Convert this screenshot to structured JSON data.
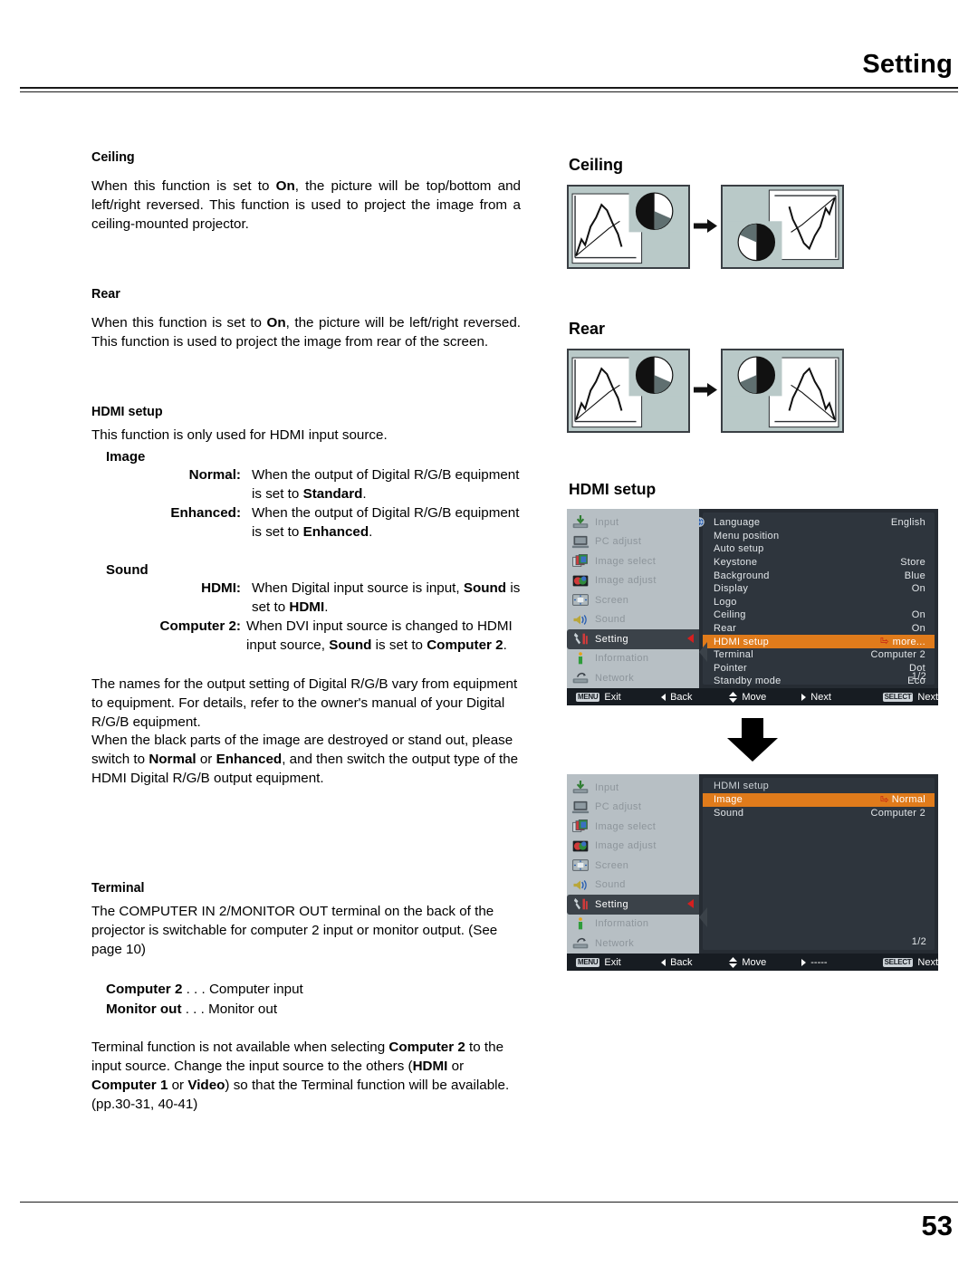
{
  "header": {
    "title": "Setting"
  },
  "footer": {
    "page_number": "53"
  },
  "sections": {
    "ceiling": {
      "heading": "Ceiling",
      "body_prefix": "When this function is set to ",
      "body_bold": "On",
      "body_suffix": ", the picture will be top/bottom and left/right reversed. This function is used to project the image from a ceiling-mounted projector."
    },
    "rear": {
      "heading": "Rear",
      "body_prefix": "When this function is set to ",
      "body_bold": "On",
      "body_suffix": ", the picture will be left/right reversed. This function is used to project the image from rear of the screen."
    },
    "hdmi_setup": {
      "heading": "HDMI setup",
      "intro": "This function is only used for HDMI input source.",
      "image_label": "Image",
      "image_items": [
        {
          "term": "Normal:",
          "desc_prefix": "When the output of Digital R/G/B equipment is set to ",
          "desc_bold": "Standard",
          "desc_suffix": "."
        },
        {
          "term": "Enhanced:",
          "desc_prefix": "When the output of Digital R/G/B equipment is set to ",
          "desc_bold": "Enhanced",
          "desc_suffix": "."
        }
      ],
      "sound_label": "Sound",
      "sound_items": [
        {
          "term": "HDMI:",
          "desc_prefix": "When Digital input source is input, ",
          "desc_bold": "Sound",
          "desc_mid": " is set to ",
          "desc_bold2": "HDMI",
          "desc_suffix": "."
        },
        {
          "term": "Computer 2:",
          "desc_prefix": "When DVI input source is changed to HDMI input source, ",
          "desc_bold": "Sound",
          "desc_mid": " is set to ",
          "desc_bold2": "Computer 2",
          "desc_suffix": "."
        }
      ],
      "note_p1": "The names for the output setting of Digital R/G/B vary from equipment to equipment. For details, refer to the owner's manual of your Digital R/G/B equipment.",
      "note_p2_a": "When the black parts of the image are destroyed or stand out, please switch to ",
      "note_p2_b1": "Normal",
      "note_p2_c": " or ",
      "note_p2_b2": "Enhanced",
      "note_p2_d": ", and then switch the output type of the HDMI Digital R/G/B output equipment."
    },
    "terminal": {
      "heading": "Terminal",
      "body": "The COMPUTER IN 2/MONITOR OUT terminal on the back of the projector is switchable for computer 2 input or monitor output. (See page 10)",
      "options": [
        {
          "term": "Computer 2",
          "sep": " . . . ",
          "value": "Computer input"
        },
        {
          "term": "Monitor out",
          "sep": " . . . ",
          "value": "Monitor out"
        }
      ],
      "note_a": "Terminal function is not available when selecting ",
      "note_b1": "Computer 2",
      "note_c": " to the input source. Change the input source to the others (",
      "note_b2": "HDMI",
      "note_d": " or ",
      "note_b3": "Computer 1",
      "note_e": " or ",
      "note_b4": "Video",
      "note_f": ") so that the Terminal function will be available. (pp.30-31, 40-41)"
    }
  },
  "figures": {
    "ceiling": {
      "title": "Ceiling"
    },
    "rear": {
      "title": "Rear"
    },
    "hdmi_setup": {
      "title": "HDMI setup"
    }
  },
  "osd": {
    "colors": {
      "highlight": "#e07b1b",
      "sidebar_bg": "#b7bfc4",
      "panel_bg": "#2e353d",
      "footer_bg": "#171c22",
      "caret_red": "#d61f1f"
    },
    "sidebar": [
      {
        "label": "Input",
        "icon": "input-icon"
      },
      {
        "label": "PC adjust",
        "icon": "pc-adjust-icon"
      },
      {
        "label": "Image select",
        "icon": "image-select-icon"
      },
      {
        "label": "Image adjust",
        "icon": "image-adjust-icon"
      },
      {
        "label": "Screen",
        "icon": "screen-icon"
      },
      {
        "label": "Sound",
        "icon": "sound-icon"
      },
      {
        "label": "Setting",
        "icon": "setting-icon"
      },
      {
        "label": "Information",
        "icon": "information-icon"
      },
      {
        "label": "Network",
        "icon": "network-icon"
      }
    ],
    "menu1": {
      "rows": [
        {
          "name": "Language",
          "value": "English"
        },
        {
          "name": "Menu position",
          "value": ""
        },
        {
          "name": "Auto setup",
          "value": ""
        },
        {
          "name": "Keystone",
          "value": "Store"
        },
        {
          "name": "Background",
          "value": "Blue"
        },
        {
          "name": "Display",
          "value": "On"
        },
        {
          "name": "Logo",
          "value": ""
        },
        {
          "name": "Ceiling",
          "value": "On"
        },
        {
          "name": "Rear",
          "value": "On"
        },
        {
          "name": "HDMI setup",
          "value": "more...",
          "highlight": true,
          "return_glyph": true
        },
        {
          "name": "Terminal",
          "value": "Computer 2"
        },
        {
          "name": "Pointer",
          "value": "Dot"
        },
        {
          "name": "Standby mode",
          "value": "Eco"
        }
      ],
      "page_indicator": "1/2",
      "footer": [
        {
          "key": "MENU",
          "label": "Exit"
        },
        {
          "icon": "triangle-left-icon",
          "label": "Back"
        },
        {
          "icon": "up-down-arrow-icon",
          "label": "Move"
        },
        {
          "icon": "triangle-right-icon",
          "label": "Next"
        },
        {
          "key": "SELECT",
          "label": "Next"
        }
      ]
    },
    "menu2": {
      "subtitle": "HDMI setup",
      "rows": [
        {
          "name": "Image",
          "value": "Normal",
          "highlight": true,
          "return_glyph": true
        },
        {
          "name": "Sound",
          "value": "Computer 2"
        }
      ],
      "page_indicator": "1/2",
      "footer": [
        {
          "key": "MENU",
          "label": "Exit"
        },
        {
          "icon": "triangle-left-icon",
          "label": "Back"
        },
        {
          "icon": "up-down-arrow-icon",
          "label": "Move"
        },
        {
          "icon": "triangle-right-icon",
          "label": "-----"
        },
        {
          "key": "SELECT",
          "label": "Next"
        }
      ]
    }
  }
}
